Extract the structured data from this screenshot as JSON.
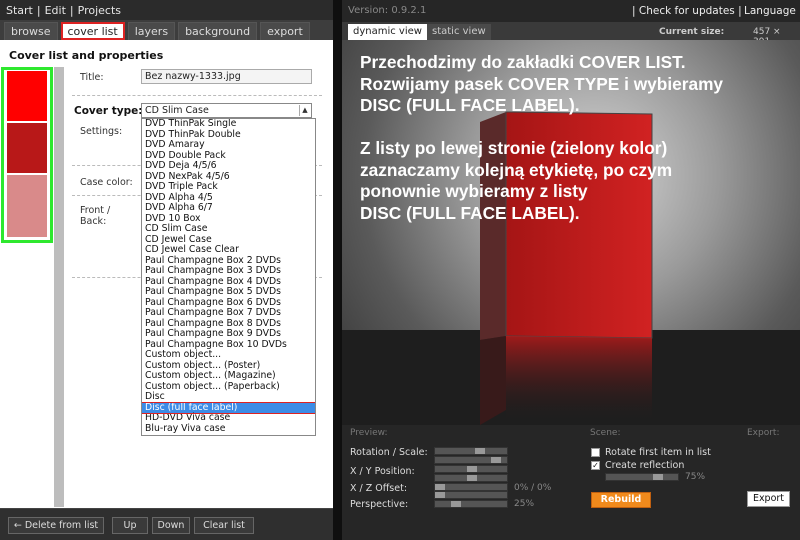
{
  "left": {
    "menu": [
      "Start",
      "|",
      "Edit",
      "|",
      "Projects"
    ],
    "tabs": [
      "browse",
      "cover list",
      "layers",
      "background",
      "export"
    ],
    "section_title": "Cover list and properties",
    "title_label": "Title:",
    "title_value": "Bez nazwy-1333.jpg",
    "cover_type_label": "Cover type:",
    "cover_type_value": "CD Slim Case",
    "settings_label": "Settings:",
    "case_color_label": "Case color:",
    "front_back_label": "Front /\nBack:",
    "dropdown_options": [
      "DVD ThinPak Single",
      "DVD ThinPak Double",
      "DVD Amaray",
      "DVD Double Pack",
      "DVD Deja 4/5/6",
      "DVD NexPak 4/5/6",
      "DVD Triple Pack",
      "DVD Alpha 4/5",
      "DVD Alpha 6/7",
      "DVD 10 Box",
      "CD Slim Case",
      "CD Jewel Case",
      "CD Jewel Case Clear",
      "Paul Champagne Box 2 DVDs",
      "Paul Champagne Box 3 DVDs",
      "Paul Champagne Box 4 DVDs",
      "Paul Champagne Box 5 DVDs",
      "Paul Champagne Box 6 DVDs",
      "Paul Champagne Box 7 DVDs",
      "Paul Champagne Box 8 DVDs",
      "Paul Champagne Box 9 DVDs",
      "Paul Champagne Box 10 DVDs",
      "Custom object...",
      "Custom object... (Poster)",
      "Custom object... (Magazine)",
      "Custom object... (Paperback)",
      "Disc",
      "Disc (full face label)",
      "HD-DVD Viva case",
      "Blu-ray Viva case"
    ],
    "selected_option": "Disc (full face label)",
    "thumb_colors": [
      "#ff0000",
      "#b81818",
      "#d98a8a"
    ],
    "buttons": {
      "delete": "← Delete from list",
      "up": "Up",
      "down": "Down",
      "clear": "Clear list"
    }
  },
  "right": {
    "version": "Version: 0.9.2.1",
    "check_updates": "|  Check for updates  |",
    "language": "Language",
    "view_tabs": [
      "dynamic view",
      "static view"
    ],
    "current_size_label": "Current size:",
    "current_size_value": "457 × 391",
    "overlay_text": "Przechodzimy do zakładki COVER LIST.\nRozwijamy pasek COVER TYPE i wybieramy\nDISC (FULL FACE LABEL).\n\nZ listy po lewej stronie (zielony kolor)\nzaznaczamy kolejną etykietę, po czym\nponownie wybieramy z listy\nDISC (FULL FACE LABEL).",
    "preview_head": "Preview:",
    "scene_head": "Scene:",
    "export_head": "Export:",
    "rotation_label": "Rotation / Scale:",
    "xy_label": "X / Y Position:",
    "xz_label": "X / Z Offset:",
    "xz_value": "0% / 0%",
    "perspective_label": "Perspective:",
    "perspective_value": "25%",
    "rotate_first": "Rotate first item in list",
    "create_reflection": "Create reflection",
    "reflection_value": "75%",
    "rebuild": "Rebuild",
    "export": "Export",
    "accent": "#f08a1c"
  }
}
